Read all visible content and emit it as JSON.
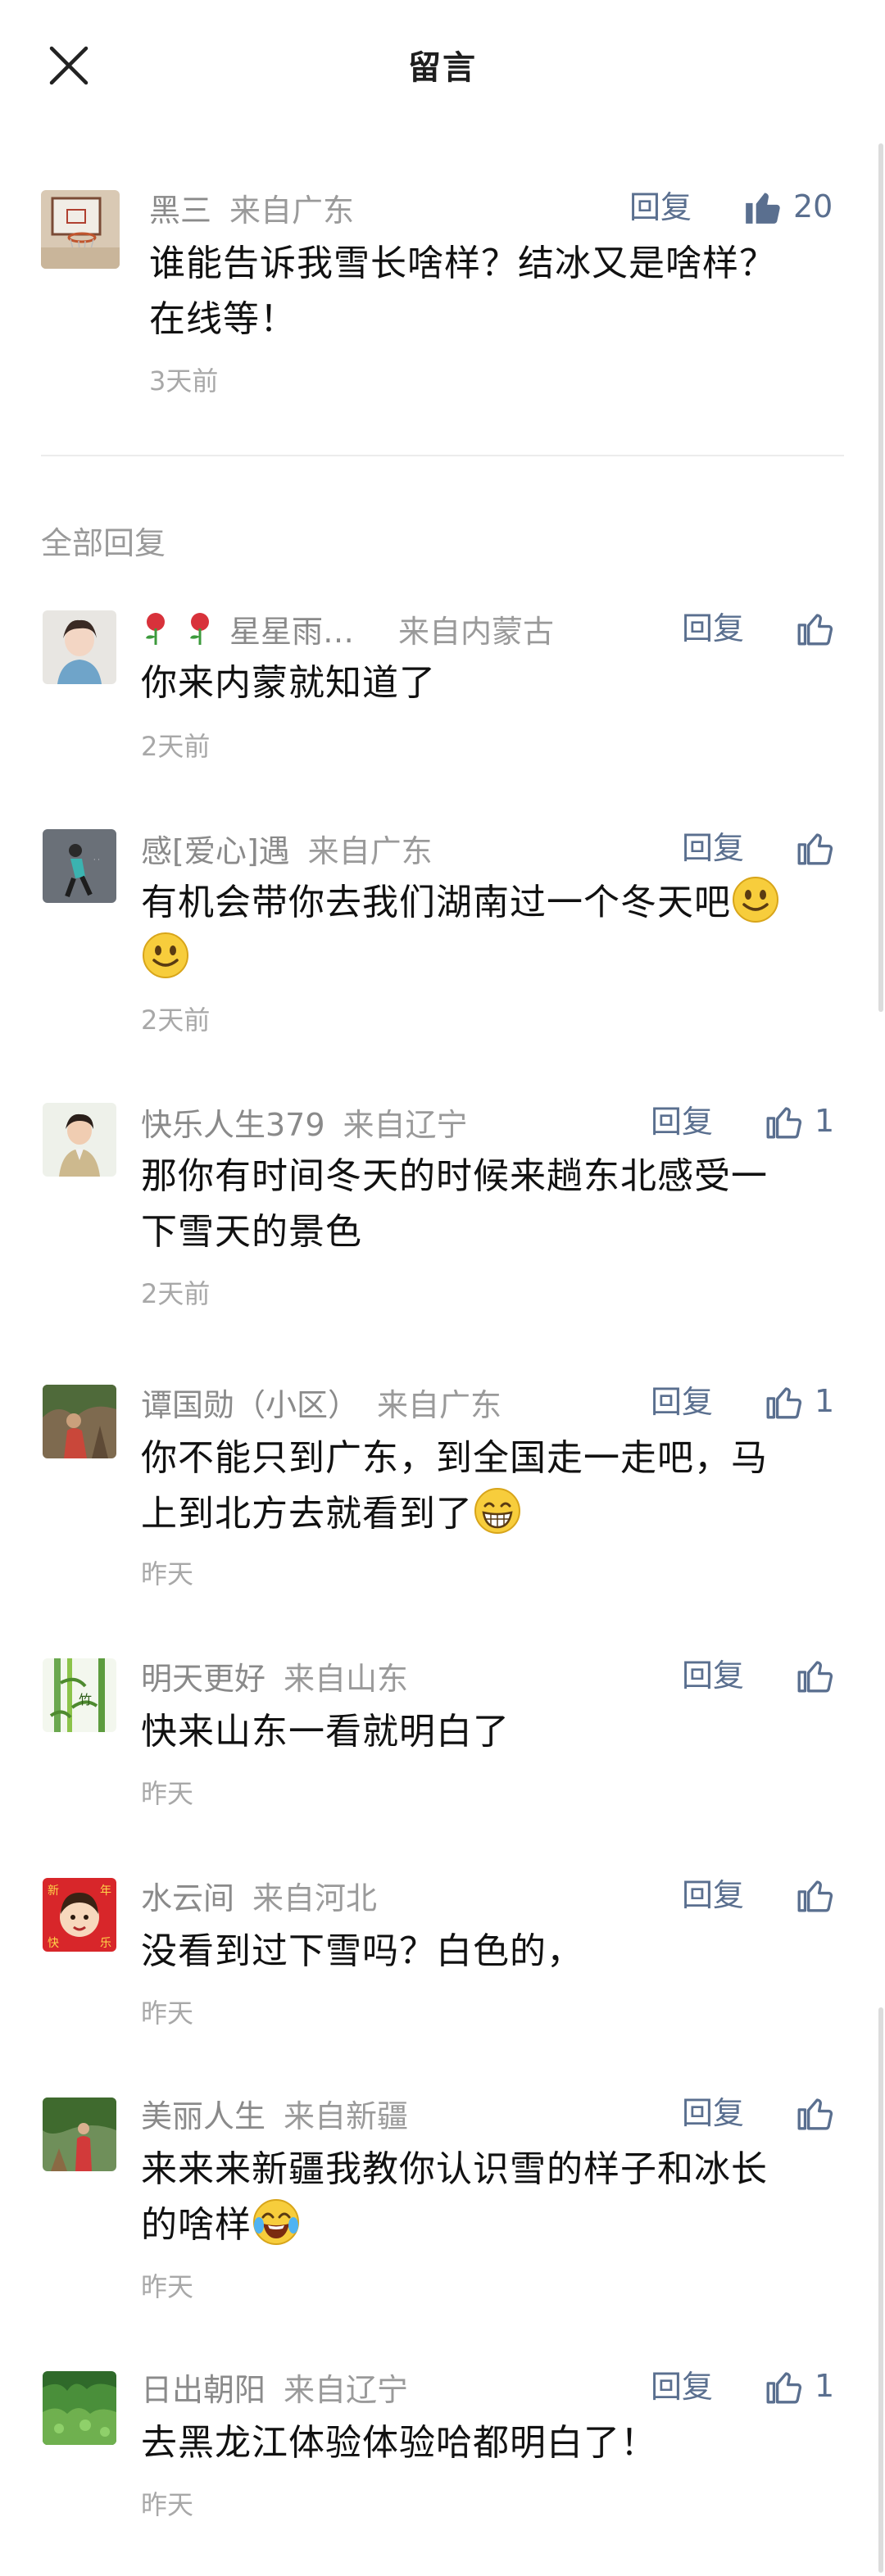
{
  "header": {
    "title": "留言"
  },
  "original": {
    "name": "黑三",
    "location": "来自广东",
    "reply_label": "回复",
    "likes": "20",
    "text_line1": "谁能告诉我雪长啥样？结冰又是啥样？",
    "text_line2": "在线等！",
    "time": "3天前"
  },
  "section_title": "全部回复",
  "replies": [
    {
      "name": "星星雨…",
      "location": "来自内蒙古",
      "reply_label": "回复",
      "likes": "",
      "lines": [
        "你来内蒙就知道了"
      ],
      "time": "2天前"
    },
    {
      "name": "感[爱心]遇",
      "location": "来自广东",
      "reply_label": "回复",
      "likes": "",
      "lines": [
        "有机会带你去我们湖南过一个冬天吧",
        ""
      ],
      "time": "2天前"
    },
    {
      "name": "快乐人生379",
      "location": "来自辽宁",
      "reply_label": "回复",
      "likes": "1",
      "lines": [
        "那你有时间冬天的时候来趟东北感受一",
        "下雪天的景色"
      ],
      "time": "2天前"
    },
    {
      "name": "谭国勋（小区）",
      "location": "来自广东",
      "reply_label": "回复",
      "likes": "1",
      "lines": [
        "你不能只到广东，到全国走一走吧，马",
        "上到北方去就看到了"
      ],
      "time": "昨天"
    },
    {
      "name": "明天更好",
      "location": "来自山东",
      "reply_label": "回复",
      "likes": "",
      "lines": [
        "快来山东一看就明白了"
      ],
      "time": "昨天"
    },
    {
      "name": "水云间",
      "location": "来自河北",
      "reply_label": "回复",
      "likes": "",
      "lines": [
        "没看到过下雪吗？白色的，"
      ],
      "time": "昨天"
    },
    {
      "name": "美丽人生",
      "location": "来自新疆",
      "reply_label": "回复",
      "likes": "",
      "lines": [
        "来来来新疆我教你认识雪的样子和冰长",
        "的啥样"
      ],
      "time": "昨天"
    },
    {
      "name": "日出朝阳",
      "location": "来自辽宁",
      "reply_label": "回复",
      "likes": "1",
      "lines": [
        "去黑龙江体验体验哈都明白了！"
      ],
      "time": "昨天"
    }
  ],
  "colors": {
    "accent": "#5a6f8f",
    "meta": "#8a8a8a",
    "text": "#111111"
  },
  "icons": [
    "close-icon",
    "thumbs-up-filled-icon",
    "thumbs-up-outline-icon",
    "smile-emoji-icon",
    "grin-emoji-icon",
    "laugh-cry-emoji-icon",
    "rose-emoji-icon"
  ]
}
